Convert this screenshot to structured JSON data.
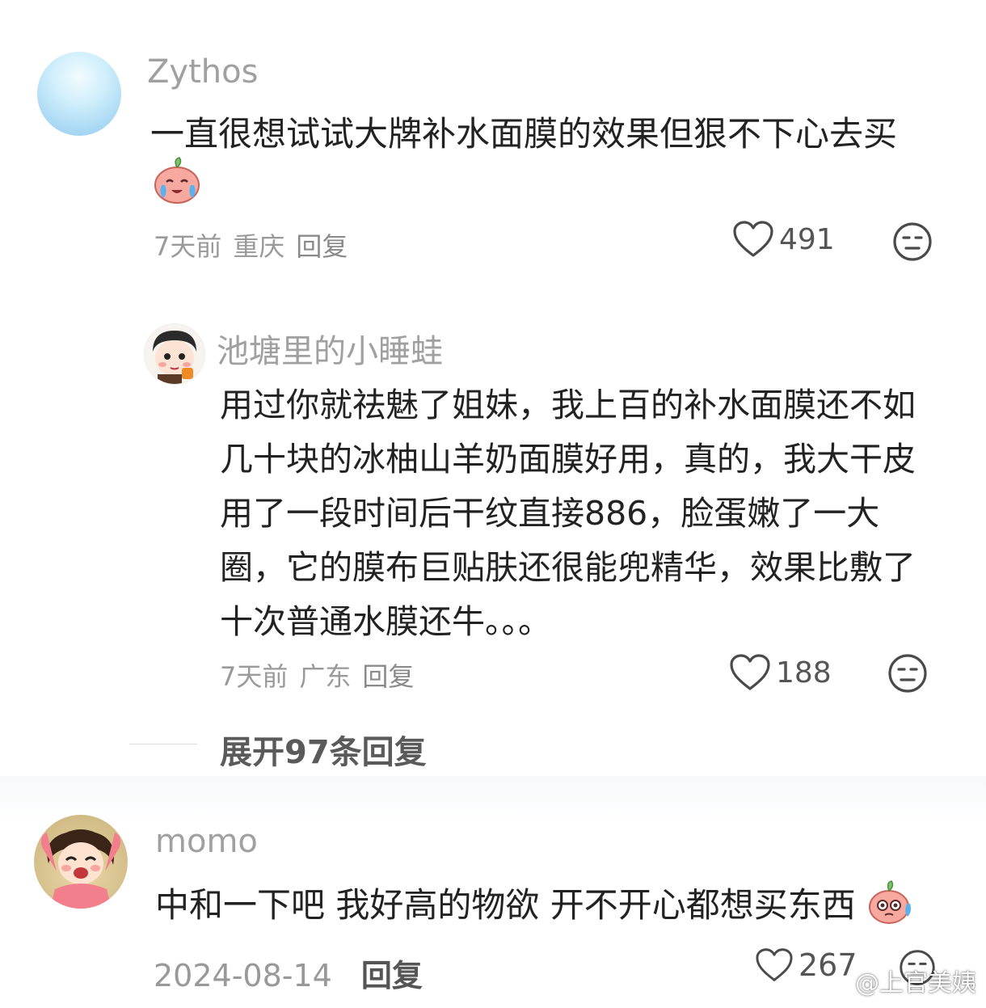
{
  "comments": [
    {
      "username": "Zythos",
      "text": "一直很想试试大牌补水面膜的效果但狠不下心去买",
      "time": "7天前",
      "location": "重庆",
      "reply_label": "回复",
      "likes": "491"
    },
    {
      "username": "池塘里的小睡蛙",
      "text": "用过你就祛魅了姐妹，我上百的补水面膜还不如几十块的冰柚山羊奶面膜好用，真的，我大干皮用了一段时间后干纹直接886，脸蛋嫩了一大圈，它的膜布巨贴肤还很能兜精华，效果比敷了十次普通水膜还牛。。。",
      "time": "7天前",
      "location": "广东",
      "reply_label": "回复",
      "likes": "188"
    },
    {
      "username": "momo",
      "text": "中和一下吧 我好高的物欲 开不开心都想买东西",
      "time": "2024-08-14",
      "reply_label": "回复",
      "likes": "267"
    }
  ],
  "expand_replies": "展开97条回复",
  "watermark": "@上官美姨",
  "icons": {
    "like": "heart-outline-icon",
    "dislike": "meh-face-icon",
    "emoji_crying": "crying-peach-emoji",
    "emoji_sweat": "sweating-peach-emoji"
  },
  "colors": {
    "username": "#a0a0a0",
    "text": "#222222",
    "meta": "#9a9a9a"
  }
}
